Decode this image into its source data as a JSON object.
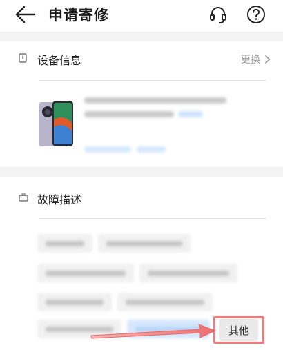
{
  "header": {
    "title": "申请寄修"
  },
  "device_section": {
    "title": "设备信息",
    "change_label": "更换"
  },
  "fault_section": {
    "title": "故障描述",
    "other_chip_label": "其他"
  },
  "colors": {
    "accent_blue": "#d6e8ff",
    "annotation_red": "#f07b7b"
  },
  "icons": {
    "back": "back-arrow-icon",
    "support": "headset-icon",
    "help": "help-icon"
  }
}
